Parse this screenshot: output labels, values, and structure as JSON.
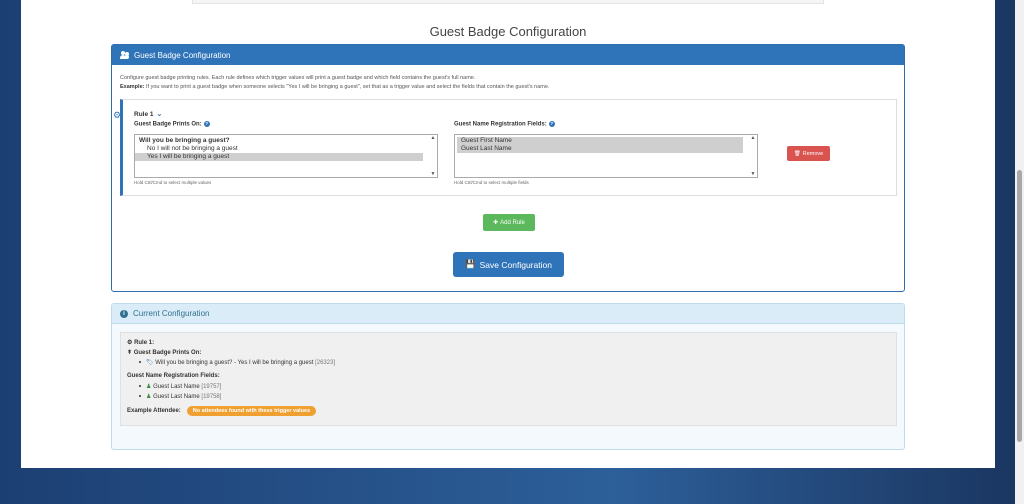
{
  "page": {
    "title": "Guest Badge Configuration"
  },
  "config_panel": {
    "header": "Guest Badge Configuration",
    "intro_line1": "Configure guest badge printing rules. Each rule defines which trigger values will print a guest badge and which field contains the guest's full name.",
    "intro_example_label": "Example:",
    "intro_example_text": "If you want to print a guest badge when someone selects \"Yes I will be bringing a guest\", set that as a trigger value and select the fields that contain the guest's name.",
    "rule": {
      "title": "Rule 1",
      "prints_on_label": "Guest Badge Prints On:",
      "prints_on_options": {
        "group": "Will you be bringing a guest?",
        "opt1": "No I will not be bringing a guest",
        "opt2": "Yes I will be bringing a guest"
      },
      "prints_on_hint": "Hold Ctrl/Cmd to select multiple values",
      "fields_label": "Guest Name Registration Fields:",
      "fields_options": {
        "opt1": "Guest First Name",
        "opt2": "Guest Last Name"
      },
      "fields_hint": "Hold Ctrl/Cmd to select multiple fields",
      "remove_label": "Remove"
    },
    "add_rule_label": "Add Rule",
    "save_label": "Save Configuration"
  },
  "current_panel": {
    "header": "Current Configuration",
    "rule_title": "Rule 1:",
    "prints_on_label": "Guest Badge Prints On:",
    "trigger_text": "Will you be bringing a guest? - Yes I will be bringing a guest",
    "trigger_id": "[26323]",
    "fields_label": "Guest Name Registration Fields:",
    "field1_text": "Guest Last Name",
    "field1_id": "[19757]",
    "field2_text": "Guest Last Name",
    "field2_id": "[19758]",
    "example_label": "Example Attendee:",
    "example_badge": "No attendees found with these trigger values"
  },
  "colors": {
    "primary": "#2f73b8",
    "danger": "#d9534f",
    "success": "#5cb85c",
    "warning": "#f0a030",
    "info": "#31708f"
  }
}
